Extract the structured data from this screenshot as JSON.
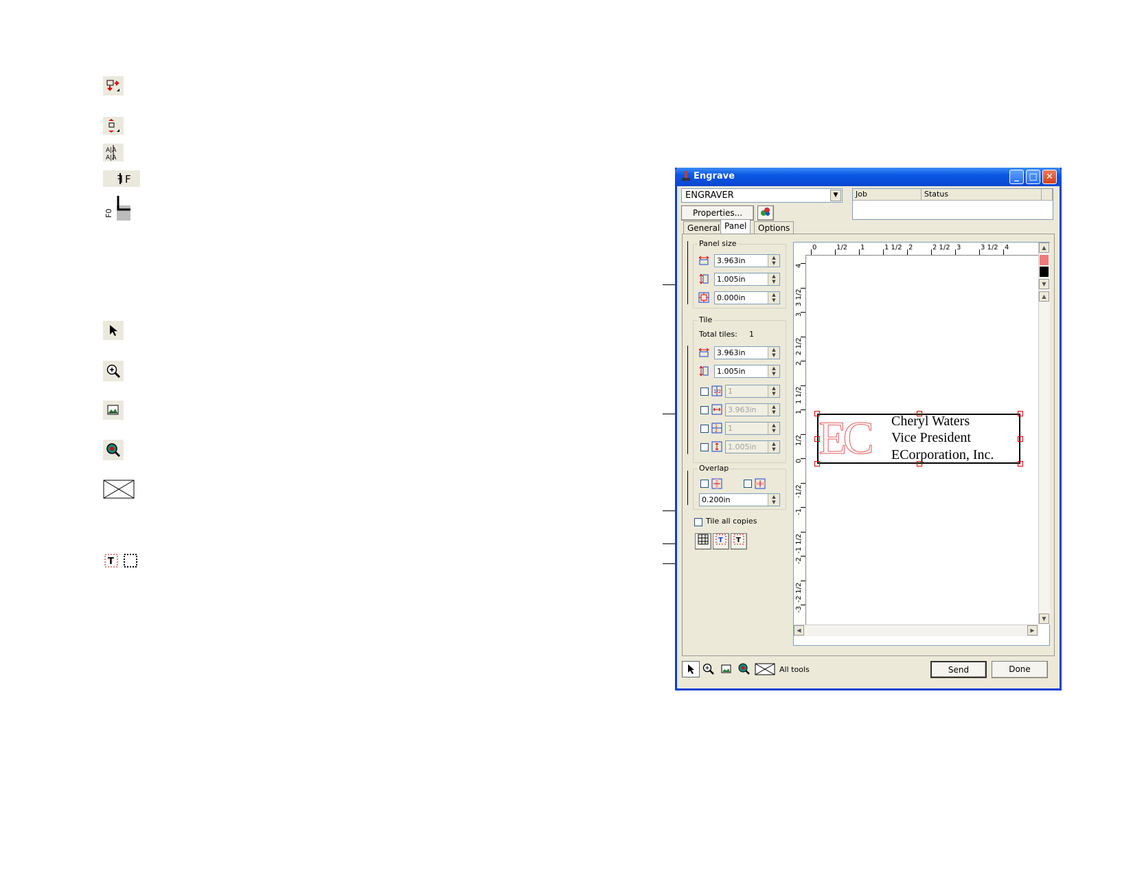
{
  "window": {
    "title": "Engrave",
    "title_icon": "engraver-icon",
    "buttons": [
      "minimize-icon",
      "maximize-icon",
      "close-icon"
    ]
  },
  "device": {
    "selected": "ENGRAVER",
    "properties_label": "Properties...",
    "job_header": "Job",
    "status_header": "Status"
  },
  "tabs": [
    "General",
    "Panel",
    "Options"
  ],
  "active_tab": "Panel",
  "panel_size": {
    "label": "Panel size",
    "width": "3.963in",
    "height": "1.005in",
    "margin": "0.000in"
  },
  "tile": {
    "label": "Tile",
    "total_label": "Total tiles:",
    "total_value": "1",
    "width": "3.963in",
    "height": "1.005in",
    "h_count": "1",
    "h_size": "3.963in",
    "v_count": "1",
    "v_size": "1.005in"
  },
  "overlap": {
    "label": "Overlap",
    "value": "0.200in"
  },
  "tile_all_copies": "Tile all copies",
  "ruler": {
    "h_labels": [
      "0",
      "1/2",
      "1",
      "1 1/2",
      "2",
      "2 1/2",
      "3",
      "3 1/2",
      "4"
    ],
    "v_labels": [
      "4",
      "3 1/2",
      "3",
      "2 1/2",
      "2",
      "1 1/2",
      "1",
      "1/2",
      "0",
      "-1/2",
      "-1",
      "-1 1/2",
      "-2",
      "-2 1/2",
      "-3"
    ]
  },
  "design": {
    "logo": "EC",
    "lines": [
      "Cheryl Waters",
      "Vice President",
      "ECorporation, Inc."
    ]
  },
  "colors": {
    "swatch_1": "#f07a7a",
    "swatch_2": "#000000",
    "accent": "#0a57e3"
  },
  "toolbar": {
    "tools": [
      "pointer-icon",
      "zoom-in-icon",
      "image-preview-icon",
      "zoom-fit-icon",
      "envelope-icon"
    ],
    "all_tools_label": "All tools",
    "send_label": "Send",
    "done_label": "Done"
  }
}
